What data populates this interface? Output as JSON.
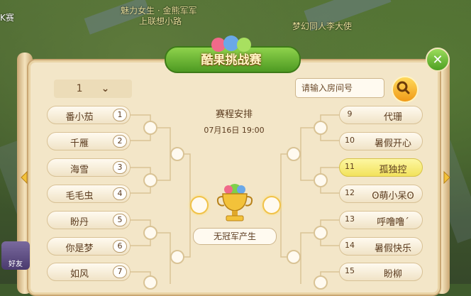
{
  "scene": {
    "top_left_text": "K赛",
    "guild_text": "魅力女生 · 金熊军军",
    "npc_guild": "上联想小路",
    "npc_name": "梦幻同人李大使",
    "friend_button": "好友"
  },
  "window": {
    "title": "酷果挑战赛",
    "close_label": "✕"
  },
  "controls": {
    "round_value": "1",
    "round_arrow": "⌄",
    "room_placeholder": "请输入房间号"
  },
  "schedule": {
    "title": "赛程安排",
    "time": "07月16日   19:00"
  },
  "champion": {
    "label": "无冠军产生"
  },
  "players_left": [
    {
      "name": "番小茄",
      "seed": "1"
    },
    {
      "name": "千雁",
      "seed": "2"
    },
    {
      "name": "海雪",
      "seed": "3"
    },
    {
      "name": "毛毛虫",
      "seed": "4"
    },
    {
      "name": "盼丹",
      "seed": "5"
    },
    {
      "name": "你是梦",
      "seed": "6"
    },
    {
      "name": "如风",
      "seed": "7"
    }
  ],
  "players_right": [
    {
      "name": "代珊",
      "seed": "9"
    },
    {
      "name": "暑假开心",
      "seed": "10"
    },
    {
      "name": "孤独控",
      "seed": "11"
    },
    {
      "name": "ʘ萌小呆ʘ",
      "seed": "12"
    },
    {
      "name": "呼噜噜´",
      "seed": "13"
    },
    {
      "name": "暑假快乐",
      "seed": "14"
    },
    {
      "name": "盼柳",
      "seed": "15"
    }
  ],
  "colors": {
    "panel_bg": "#f3e6c8",
    "highlight": "#f2e25c",
    "accent_green": "#4e9a22",
    "search_orange": "#f09a18"
  }
}
